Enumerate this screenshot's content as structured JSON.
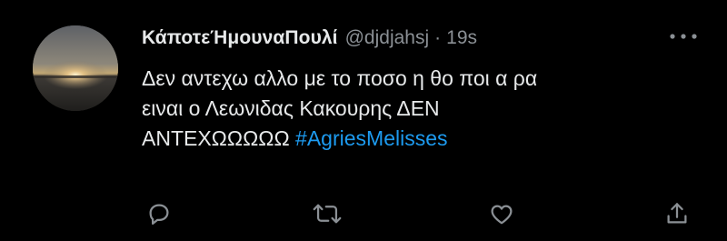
{
  "tweet": {
    "display_name": "ΚάποτεΉμουναΠουλί",
    "handle": "@djdjahsj",
    "separator": "·",
    "time": "19s",
    "text_line1": "Δεν αντεχω αλλο με το ποσο η θο ποι α ρα",
    "text_line2": "ειναι ο Λεωνιδας Κακουρης ΔΕΝ",
    "text_line3": "ΑΝΤΕΧΩΩΩΩΩ",
    "hashtag": "#AgriesMelisses"
  },
  "icons": {
    "more": "more-horizontal-icon",
    "reply": "reply-icon",
    "retweet": "retweet-icon",
    "like": "like-icon",
    "share": "share-icon"
  },
  "colors": {
    "background": "#000000",
    "text": "#e7e9ea",
    "secondary": "#8b9095",
    "hashtag": "#1d9bf0"
  }
}
